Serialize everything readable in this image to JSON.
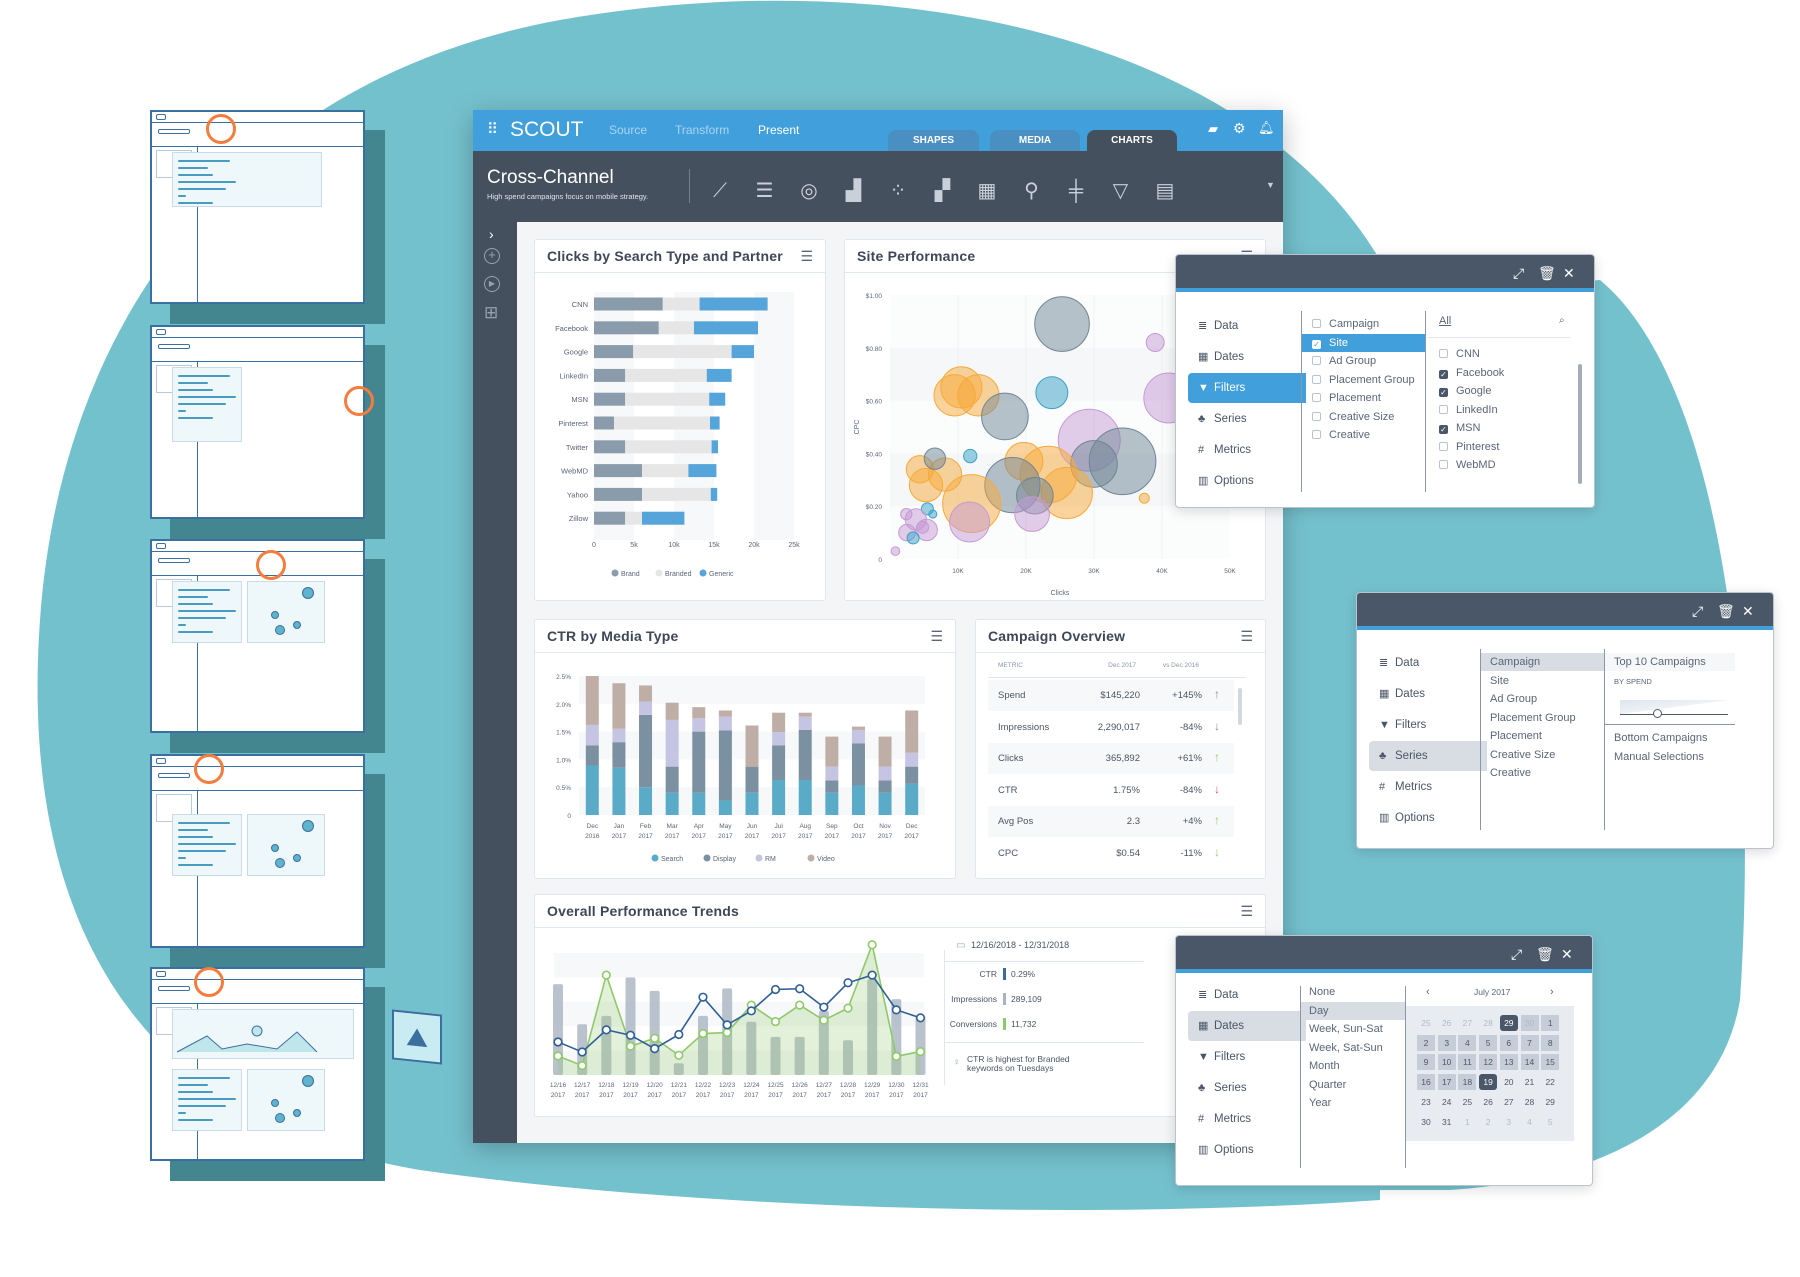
{
  "app": {
    "name": "SCOUT",
    "nav": [
      "Source",
      "Transform",
      "Present"
    ],
    "tabs": [
      "SHAPES",
      "MEDIA",
      "CHARTS"
    ],
    "active_tab": "CHARTS",
    "header_icons": [
      "folder-open-icon",
      "gear-icon",
      "bell-icon"
    ],
    "title": "Cross-Channel",
    "subtitle": "High spend campaigns focus on mobile strategy.",
    "chart_type_icons": [
      "line-chart-icon",
      "bar-chart-icon",
      "donut-chart-icon",
      "combo-chart-icon",
      "scatter-chart-icon",
      "stacked-chart-icon",
      "table-icon",
      "map-pin-icon",
      "boxplot-icon",
      "funnel-icon",
      "layout-icon"
    ],
    "colors": {
      "brand_blue": "#41a0dc",
      "dark": "#45505f",
      "teal_bg": "#74c1ce"
    }
  },
  "cards": {
    "clicks": {
      "title": "Clicks by Search Type and Partner"
    },
    "site": {
      "title": "Site Performance"
    },
    "ctr": {
      "title": "CTR by Media Type"
    },
    "campaign": {
      "title": "Campaign Overview",
      "columns": [
        "METRIC",
        "Dec 2017",
        "vs Dec 2016"
      ],
      "rows": [
        {
          "metric": "Spend",
          "value": "$145,220",
          "change": "+145%",
          "trend": "up",
          "color": "#8a8f96"
        },
        {
          "metric": "Impressions",
          "value": "2,290,017",
          "change": "-84%",
          "trend": "down",
          "color": "#8a8f96"
        },
        {
          "metric": "Clicks",
          "value": "365,892",
          "change": "+61%",
          "trend": "up",
          "color": "#8fd16a"
        },
        {
          "metric": "CTR",
          "value": "1.75%",
          "change": "-84%",
          "trend": "down",
          "color": "#e0595c"
        },
        {
          "metric": "Avg Pos",
          "value": "2.3",
          "change": "+4%",
          "trend": "up",
          "color": "#8fd16a"
        },
        {
          "metric": "CPC",
          "value": "$0.54",
          "change": "-11%",
          "trend": "down",
          "color": "#8fd16a"
        }
      ]
    },
    "trends": {
      "title": "Overall Performance Trends",
      "date_range": "12/16/2018 - 12/31/2018",
      "stats": [
        {
          "label": "CTR",
          "value": "0.29%",
          "color": "#3b6aa0"
        },
        {
          "label": "Impressions",
          "value": "289,109",
          "color": "#a9b4c0"
        },
        {
          "label": "Conversions",
          "value": "11,732",
          "color": "#8fc96a"
        }
      ],
      "tip": "CTR is highest for Branded keywords on Tuesdays"
    }
  },
  "chart_data": [
    {
      "type": "bar",
      "orientation": "horizontal",
      "stacked": true,
      "title": "Clicks by Search Type and Partner",
      "categories": [
        "CNN",
        "Facebook",
        "Google",
        "LinkedIn",
        "MSN",
        "Pinterest",
        "Twitter",
        "WebMD",
        "Yahoo",
        "Zillow"
      ],
      "series": [
        {
          "name": "Brand",
          "color": "#8a9cab",
          "values": [
            8.6,
            8.1,
            4.9,
            3.9,
            3.9,
            2.5,
            3.9,
            6.0,
            6.0,
            3.9
          ]
        },
        {
          "name": "Branded",
          "color": "#e6e6e6",
          "values": [
            4.6,
            4.4,
            12.3,
            10.2,
            10.5,
            12.0,
            10.8,
            5.8,
            8.6,
            2.1
          ]
        },
        {
          "name": "Generic",
          "color": "#55a5da",
          "values": [
            8.5,
            8.0,
            2.8,
            3.1,
            2.0,
            1.2,
            0.8,
            3.5,
            0.8,
            5.3
          ]
        }
      ],
      "unit": "k",
      "xlim": [
        0,
        25
      ],
      "xticks": [
        "0",
        "5k",
        "10k",
        "15k",
        "20k",
        "25k"
      ],
      "legend": "bottom"
    },
    {
      "type": "scatter",
      "bubble": true,
      "title": "Site Performance",
      "xlabel": "Clicks",
      "ylabel": "CPC",
      "xlim": [
        0,
        50
      ],
      "ylim": [
        0,
        1
      ],
      "xticks": [
        "10K",
        "20K",
        "30K",
        "40K",
        "50K"
      ],
      "yticks": [
        "0",
        "$0.20",
        "$0.40",
        "$0.60",
        "$0.80",
        "$1.00"
      ],
      "colors": {
        "orange": "#f7a93a",
        "grey": "#6f8596",
        "purple": "#c59ad6",
        "teal": "#3aa2c8"
      },
      "points": [
        {
          "x": 25.3,
          "y": 0.89,
          "size": 8.2,
          "c": "grey"
        },
        {
          "x": 39,
          "y": 0.82,
          "size": 2.7,
          "c": "purple"
        },
        {
          "x": 10.5,
          "y": 0.65,
          "size": 6.2,
          "c": "orange"
        },
        {
          "x": 9.5,
          "y": 0.62,
          "size": 6.2,
          "c": "orange"
        },
        {
          "x": 13,
          "y": 0.62,
          "size": 6.2,
          "c": "orange"
        },
        {
          "x": 16.9,
          "y": 0.54,
          "size": 7.0,
          "c": "grey"
        },
        {
          "x": 23.8,
          "y": 0.63,
          "size": 4.8,
          "c": "teal"
        },
        {
          "x": 41,
          "y": 0.61,
          "size": 7.5,
          "c": "purple"
        },
        {
          "x": 29.3,
          "y": 0.45,
          "size": 9.3,
          "c": "purple"
        },
        {
          "x": 30,
          "y": 0.36,
          "size": 7.0,
          "c": "grey"
        },
        {
          "x": 34.2,
          "y": 0.37,
          "size": 10.0,
          "c": "grey"
        },
        {
          "x": 19.7,
          "y": 0.37,
          "size": 5.7,
          "c": "orange"
        },
        {
          "x": 23.3,
          "y": 0.32,
          "size": 8.5,
          "c": "orange"
        },
        {
          "x": 26,
          "y": 0.25,
          "size": 7.7,
          "c": "orange"
        },
        {
          "x": 18,
          "y": 0.28,
          "size": 8.3,
          "c": "grey"
        },
        {
          "x": 21.3,
          "y": 0.24,
          "size": 5.5,
          "c": "grey"
        },
        {
          "x": 20.9,
          "y": 0.17,
          "size": 5.2,
          "c": "purple"
        },
        {
          "x": 12,
          "y": 0.21,
          "size": 8.7,
          "c": "orange"
        },
        {
          "x": 11.7,
          "y": 0.14,
          "size": 6.0,
          "c": "purple"
        },
        {
          "x": 4.4,
          "y": 0.34,
          "size": 4.1,
          "c": "orange"
        },
        {
          "x": 5.3,
          "y": 0.28,
          "size": 5.0,
          "c": "orange"
        },
        {
          "x": 8.1,
          "y": 0.32,
          "size": 5.0,
          "c": "orange"
        },
        {
          "x": 6.6,
          "y": 0.38,
          "size": 3.2,
          "c": "grey"
        },
        {
          "x": 11.8,
          "y": 0.39,
          "size": 2.0,
          "c": "teal"
        },
        {
          "x": 37.4,
          "y": 0.23,
          "size": 1.5,
          "c": "orange"
        },
        {
          "x": 5.5,
          "y": 0.19,
          "size": 1.8,
          "c": "teal"
        },
        {
          "x": 6.3,
          "y": 0.17,
          "size": 1.2,
          "c": "teal"
        },
        {
          "x": 2.4,
          "y": 0.17,
          "size": 1.7,
          "c": "purple"
        },
        {
          "x": 3.8,
          "y": 0.15,
          "size": 3.2,
          "c": "purple"
        },
        {
          "x": 5.4,
          "y": 0.11,
          "size": 3.2,
          "c": "purple"
        },
        {
          "x": 2.5,
          "y": 0.1,
          "size": 2.5,
          "c": "purple"
        },
        {
          "x": 4.8,
          "y": 0.12,
          "size": 1.8,
          "c": "purple"
        },
        {
          "x": 3.4,
          "y": 0.08,
          "size": 1.8,
          "c": "teal"
        },
        {
          "x": 0.8,
          "y": 0.03,
          "size": 1.3,
          "c": "purple"
        }
      ]
    },
    {
      "type": "bar",
      "stacked": true,
      "title": "CTR by Media Type",
      "categories": [
        "Dec 2016",
        "Jan 2017",
        "Feb 2017",
        "Mar 2017",
        "Apr 2017",
        "May 2017",
        "Jun 2017",
        "Jul 2017",
        "Aug 2017",
        "Sep 2017",
        "Oct 2017",
        "Nov 2017",
        "Dec 2017"
      ],
      "series": [
        {
          "name": "Search",
          "color": "#5aabc8",
          "values": [
            0.89,
            0.85,
            0.5,
            0.4,
            0.4,
            0.26,
            0.4,
            0.63,
            0.63,
            0.4,
            0.53,
            0.4,
            0.56
          ]
        },
        {
          "name": "Display",
          "color": "#7b90a1",
          "values": [
            0.36,
            0.46,
            1.3,
            0.47,
            1.1,
            1.26,
            0.47,
            0.62,
            0.9,
            0.22,
            0.76,
            0.22,
            0.31
          ]
        },
        {
          "name": "RM",
          "color": "#c6c4e3",
          "values": [
            0.37,
            0.24,
            0.24,
            0.84,
            0.24,
            0.25,
            0.0,
            0.24,
            0.24,
            0.25,
            0.24,
            0.25,
            0.25
          ]
        },
        {
          "name": "Video",
          "color": "#bfaea5",
          "values": [
            0.88,
            0.82,
            0.29,
            0.31,
            0.2,
            0.11,
            0.74,
            0.35,
            0.07,
            0.54,
            0.06,
            0.54,
            0.76
          ]
        }
      ],
      "ylim": [
        0,
        2.5
      ],
      "yticks": [
        "0",
        "0.5%",
        "1.0%",
        "1.5%",
        "2.0%",
        "2.5%"
      ],
      "legend": "bottom"
    },
    {
      "type": "line",
      "title": "Overall Performance Trends",
      "categories": [
        "12/16 2017",
        "12/17 2017",
        "12/18 2017",
        "12/19 2017",
        "12/20 2017",
        "12/21 2017",
        "12/22 2017",
        "12/23 2017",
        "12/24 2017",
        "12/25 2017",
        "12/26 2017",
        "12/27 2017",
        "12/28 2017",
        "12/29 2017",
        "12/30 2017",
        "12/31 2017"
      ],
      "series": [
        {
          "name": "Impressions",
          "type": "bar",
          "color": "#a9b4c0",
          "values": [
            74.5,
            41.6,
            48.5,
            80,
            69,
            9.6,
            48.5,
            71,
            43.6,
            31.2,
            31.2,
            52.6,
            28.5,
            78.6,
            62.2,
            48.5
          ]
        },
        {
          "name": "CTR",
          "type": "line",
          "color": "#2f5f96",
          "values": [
            27.1,
            18.9,
            37,
            32.6,
            21.6,
            33.2,
            63.8,
            41.1,
            52.6,
            70.1,
            70.7,
            55.6,
            75.6,
            81.9,
            53.4,
            46.8
          ]
        },
        {
          "name": "Conversions",
          "type": "area",
          "color": "#8fc96a",
          "values": [
            15.6,
            7.7,
            81.9,
            23.6,
            30.1,
            16.2,
            34,
            34.8,
            57.3,
            43.8,
            57.3,
            44.9,
            54.8,
            106.8,
            15.3,
            19.2
          ]
        }
      ],
      "ylim": [
        0,
        100
      ],
      "axes_labels": false
    }
  ],
  "panels": {
    "menu": [
      {
        "label": "Data",
        "icon": "database-icon",
        "glyph": "≣"
      },
      {
        "label": "Dates",
        "icon": "calendar-icon",
        "glyph": "▦"
      },
      {
        "label": "Filters",
        "icon": "filter-icon",
        "glyph": "▼"
      },
      {
        "label": "Series",
        "icon": "hierarchy-icon",
        "glyph": "♣"
      },
      {
        "label": "Metrics",
        "icon": "hash-icon",
        "glyph": "#"
      },
      {
        "label": "Options",
        "icon": "bar-chart-icon",
        "glyph": "▥"
      }
    ],
    "filters": {
      "active_menu": "Filters",
      "dimensions": [
        {
          "label": "Campaign",
          "checked": false
        },
        {
          "label": "Site",
          "checked": true
        },
        {
          "label": "Ad Group",
          "checked": false
        },
        {
          "label": "Placement Group",
          "checked": false
        },
        {
          "label": "Placement",
          "checked": false
        },
        {
          "label": "Creative Size",
          "checked": false
        },
        {
          "label": "Creative",
          "checked": false
        }
      ],
      "search_value": "All",
      "values": [
        {
          "label": "CNN",
          "checked": false
        },
        {
          "label": "Facebook",
          "checked": true
        },
        {
          "label": "Google",
          "checked": true
        },
        {
          "label": "LinkedIn",
          "checked": false
        },
        {
          "label": "MSN",
          "checked": true
        },
        {
          "label": "Pinterest",
          "checked": false
        },
        {
          "label": "WebMD",
          "checked": false
        }
      ]
    },
    "series": {
      "active_menu": "Series",
      "dimensions": [
        "Campaign",
        "Site",
        "Ad Group",
        "Placement Group",
        "Placement",
        "Creative Size",
        "Creative"
      ],
      "selected": "Campaign",
      "options": {
        "top": "Top 10 Campaigns",
        "by": "BY SPEND",
        "slider_value": 10,
        "others": [
          "Bottom Campaigns",
          "Manual Selections"
        ]
      }
    },
    "dates": {
      "active_menu": "Dates",
      "granularity": [
        "None",
        "Day",
        "Week, Sun-Sat",
        "Week, Sat-Sun",
        "Month",
        "Quarter",
        "Year"
      ],
      "selected": "Day",
      "calendar": {
        "month": "July 2017",
        "days": [
          [
            "25",
            "26",
            "27",
            "28",
            "29",
            "30",
            "1"
          ],
          [
            "2",
            "3",
            "4",
            "5",
            "6",
            "7",
            "8"
          ],
          [
            "9",
            "10",
            "11",
            "12",
            "13",
            "14",
            "15"
          ],
          [
            "16",
            "17",
            "18",
            "19",
            "20",
            "21",
            "22"
          ],
          [
            "23",
            "24",
            "25",
            "26",
            "27",
            "28",
            "29"
          ],
          [
            "30",
            "31",
            "1",
            "2",
            "3",
            "4",
            "5"
          ]
        ],
        "range_start": "29 Jun",
        "range_end": "19 Jul"
      }
    }
  }
}
